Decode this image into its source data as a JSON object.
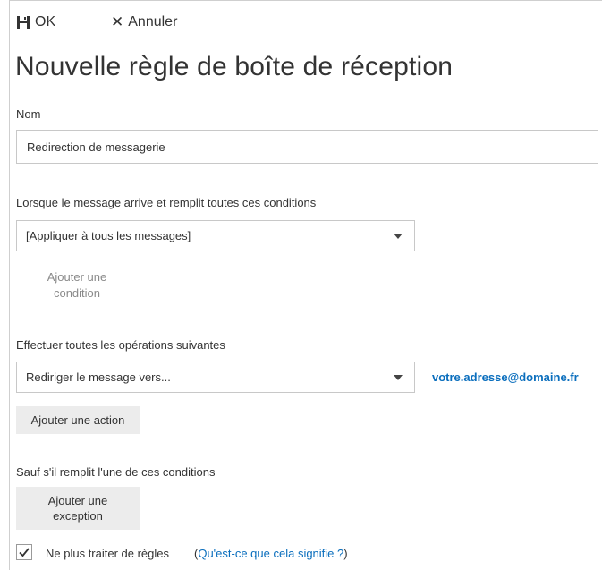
{
  "toolbar": {
    "ok_label": "OK",
    "cancel_label": "Annuler"
  },
  "page_title": "Nouvelle règle de boîte de réception",
  "name_section": {
    "label": "Nom",
    "value": "Redirection de messagerie"
  },
  "conditions": {
    "label": "Lorsque le message arrive et remplit toutes ces conditions",
    "selected": "[Appliquer à tous les messages]",
    "add_condition": "Ajouter une condition"
  },
  "actions": {
    "label": "Effectuer toutes les opérations suivantes",
    "selected": "Rediriger le message vers...",
    "recipient": "votre.adresse@domaine.fr",
    "add_action": "Ajouter une action"
  },
  "exceptions": {
    "label": "Sauf s'il remplit l'une de ces conditions",
    "add_exception": "Ajouter une exception"
  },
  "stop_rules": {
    "checked": true,
    "label": "Ne plus traiter de règles",
    "help_open": "(",
    "help_link": "Qu'est-ce que cela signifie ?",
    "help_close": ")"
  },
  "colors": {
    "link": "#0a6ebd",
    "button_bg": "#ececec",
    "border": "#c8c8c8"
  },
  "icons": [
    "save-icon",
    "close-icon",
    "chevron-down-icon",
    "checkmark-icon"
  ]
}
